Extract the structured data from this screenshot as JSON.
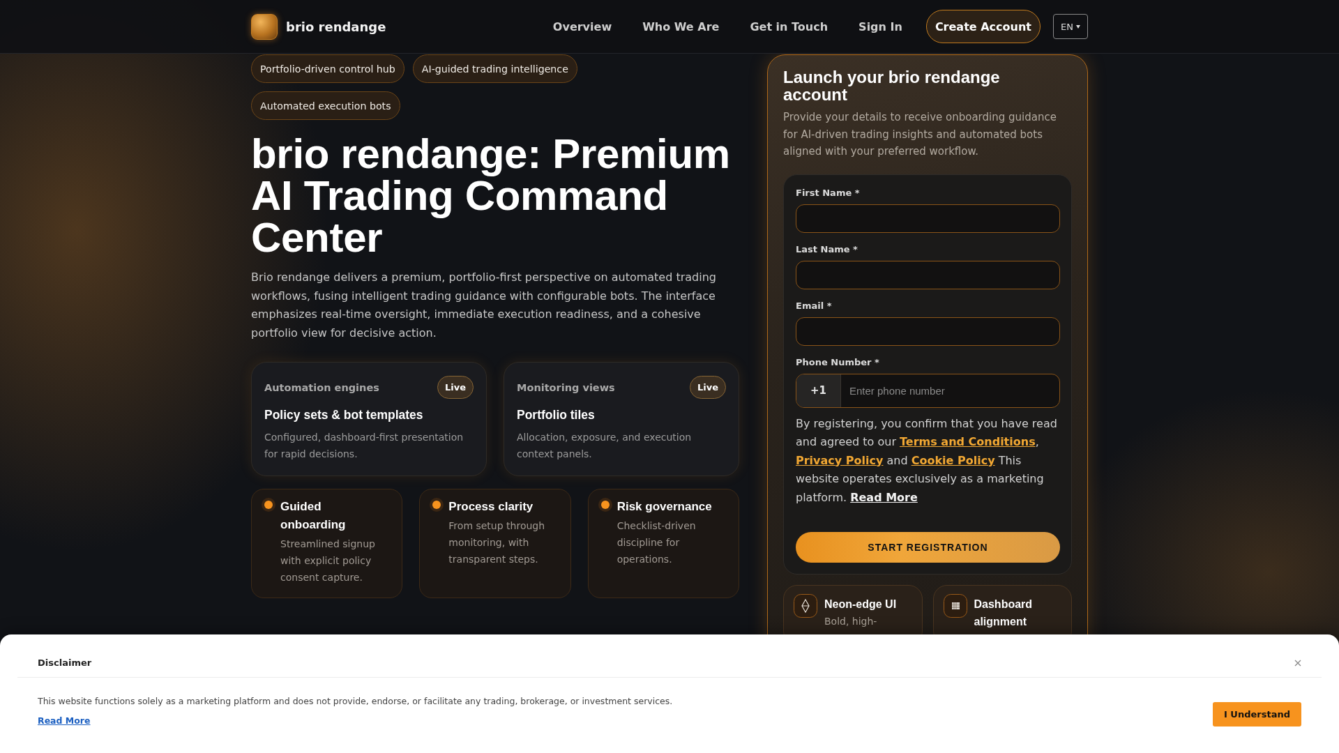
{
  "header": {
    "brand": "brio rendange",
    "nav": [
      "Overview",
      "Who We Are",
      "Get in Touch",
      "Sign In"
    ],
    "cta": "Create Account",
    "language": "EN"
  },
  "tags": [
    "Portfolio-driven control hub",
    "AI-guided trading intelligence",
    "Automated execution bots"
  ],
  "hero": {
    "title": "brio rendange: Premium AI Trading Command Center",
    "description": "Brio rendange delivers a premium, portfolio-first perspective on automated trading workflows, fusing intelligent trading guidance with configurable bots. The interface emphasizes real-time oversight, immediate execution readiness, and a cohesive portfolio view for decisive action."
  },
  "feature_cards": [
    {
      "category": "Automation engines",
      "badge": "Live",
      "title": "Policy sets & bot templates",
      "description": "Configured, dashboard-first presentation for rapid decisions."
    },
    {
      "category": "Monitoring views",
      "badge": "Live",
      "title": "Portfolio tiles",
      "description": "Allocation, exposure, and execution context panels."
    }
  ],
  "highlights": [
    {
      "title": "Guided onboarding",
      "description": "Streamlined signup with explicit policy consent capture."
    },
    {
      "title": "Process clarity",
      "description": "From setup through monitoring, with transparent steps."
    },
    {
      "title": "Risk governance",
      "description": "Checklist-driven discipline for operations."
    }
  ],
  "signup": {
    "title": "Launch your brio rendange account",
    "description": "Provide your details to receive onboarding guidance for AI-driven trading insights and automated bots aligned with your preferred workflow.",
    "fields": [
      {
        "kind": "text",
        "label": "First Name *"
      },
      {
        "kind": "text",
        "label": "Last Name *"
      },
      {
        "kind": "text",
        "label": "Email *"
      },
      {
        "kind": "phone",
        "label": "Phone Number *",
        "prefix": "+1",
        "placeholder": "Enter phone number"
      }
    ],
    "consent": [
      {
        "kind": "text",
        "text": "By registering, you confirm that you have read and agreed to our "
      },
      {
        "kind": "policy_link",
        "text": "Terms and Conditions"
      },
      {
        "kind": "text",
        "text": ", "
      },
      {
        "kind": "policy_link",
        "text": "Privacy Policy"
      },
      {
        "kind": "text",
        "text": " and "
      },
      {
        "kind": "policy_link",
        "text": "Cookie Policy"
      },
      {
        "kind": "text",
        "text": " This website operates exclusively as a marketing platform. "
      },
      {
        "kind": "read_more",
        "text": "Read More"
      }
    ],
    "submit": "START REGISTRATION",
    "perks": [
      {
        "title": "Neon-edge UI",
        "description": "Bold, high-"
      },
      {
        "title": "Dashboard alignment"
      }
    ]
  },
  "disclaimer": {
    "title": "Disclaimer",
    "text": "This website functions solely as a marketing platform and does not provide, endorse, or facilitate any trading, brokerage, or investment services.",
    "link": "Read More",
    "button": "I Understand"
  }
}
